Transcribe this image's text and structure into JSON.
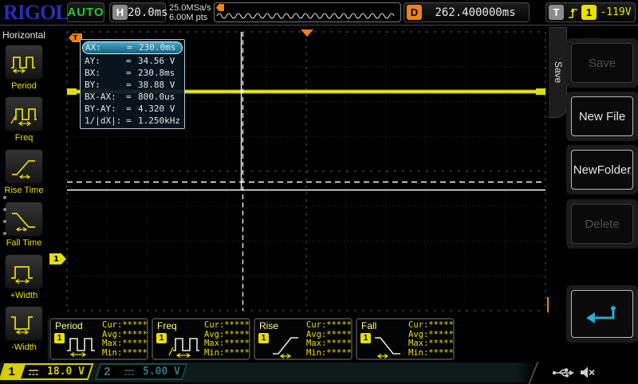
{
  "top_bar": {
    "logo": "RIGOL",
    "trigger_status": "AUTO",
    "horizontal_label": "H",
    "timebase": "20.0ms",
    "sample_rate": "25.0MSa/s",
    "memory_depth": "6.00M pts",
    "delay_label": "D",
    "delay_value": "262.400000ms",
    "trigger_label": "T",
    "trigger_source": "1",
    "trigger_level": "-119V"
  },
  "left_menu": {
    "title": "Horizontal",
    "items": [
      {
        "label": "Period",
        "icon": "period-icon"
      },
      {
        "label": "Freq",
        "icon": "freq-icon"
      },
      {
        "label": "Rise Time",
        "icon": "rise-time-icon"
      },
      {
        "label": "Fall Time",
        "icon": "fall-time-icon"
      },
      {
        "label": "+Width",
        "icon": "plus-width-icon"
      },
      {
        "label": "-Width",
        "icon": "minus-width-icon"
      }
    ]
  },
  "cursor_readout": {
    "equals": "=",
    "rows": [
      {
        "label": "AX:",
        "value": "230.0ms"
      },
      {
        "label": "AY:",
        "value": "34.56 V"
      },
      {
        "label": "BX:",
        "value": "230.8ms"
      },
      {
        "label": "BY:",
        "value": "38.88 V"
      },
      {
        "label": "BX-AX:",
        "value": "800.0us"
      },
      {
        "label": "BY-AY:",
        "value": "4.320 V"
      },
      {
        "label": "1/|dX|:",
        "value": "1.250kHz"
      }
    ]
  },
  "graticule": {
    "trigger_position_marker": "T",
    "trigger_level_marker": "T",
    "channel_marker": "1"
  },
  "right_menu": {
    "tab_label": "Save",
    "buttons": [
      {
        "label": "Save",
        "enabled": false
      },
      {
        "label": "New File",
        "enabled": true
      },
      {
        "label": "NewFolder",
        "enabled": true
      },
      {
        "label": "Delete",
        "enabled": false
      }
    ],
    "return_button_icon": "return-arrow-icon"
  },
  "measurements": [
    {
      "title": "Period",
      "channel": "1",
      "icon": "period-icon",
      "stats": [
        "Cur:*****",
        "Avg:*****",
        "Max:*****",
        "Min:*****"
      ]
    },
    {
      "title": "Freq",
      "channel": "1",
      "icon": "freq-icon",
      "stats": [
        "Cur:*****",
        "Avg:*****",
        "Max:*****",
        "Min:*****"
      ]
    },
    {
      "title": "Rise",
      "channel": "1",
      "icon": "rise-time-icon",
      "stats": [
        "Cur:*****",
        "Avg:*****",
        "Max:*****",
        "Min:*****"
      ]
    },
    {
      "title": "Fall",
      "channel": "1",
      "icon": "fall-time-icon",
      "stats": [
        "Cur:*****",
        "Avg:*****",
        "Max:*****",
        "Min:*****"
      ]
    }
  ],
  "status_bar": {
    "channels": [
      {
        "id": "1",
        "scale": "18.0 V",
        "active": true
      },
      {
        "id": "2",
        "scale": "5.00 V",
        "active": false
      }
    ],
    "icons": [
      "usb-icon",
      "speaker-muted-icon"
    ]
  },
  "colors": {
    "channel1_yellow": "#e8e000",
    "channel2_teal": "#2e7d7d",
    "trigger_orange": "#f08318",
    "auto_green": "#1ecc2e",
    "logo_blue": "#2531b5",
    "cursor_highlight": "#2d85a8"
  }
}
